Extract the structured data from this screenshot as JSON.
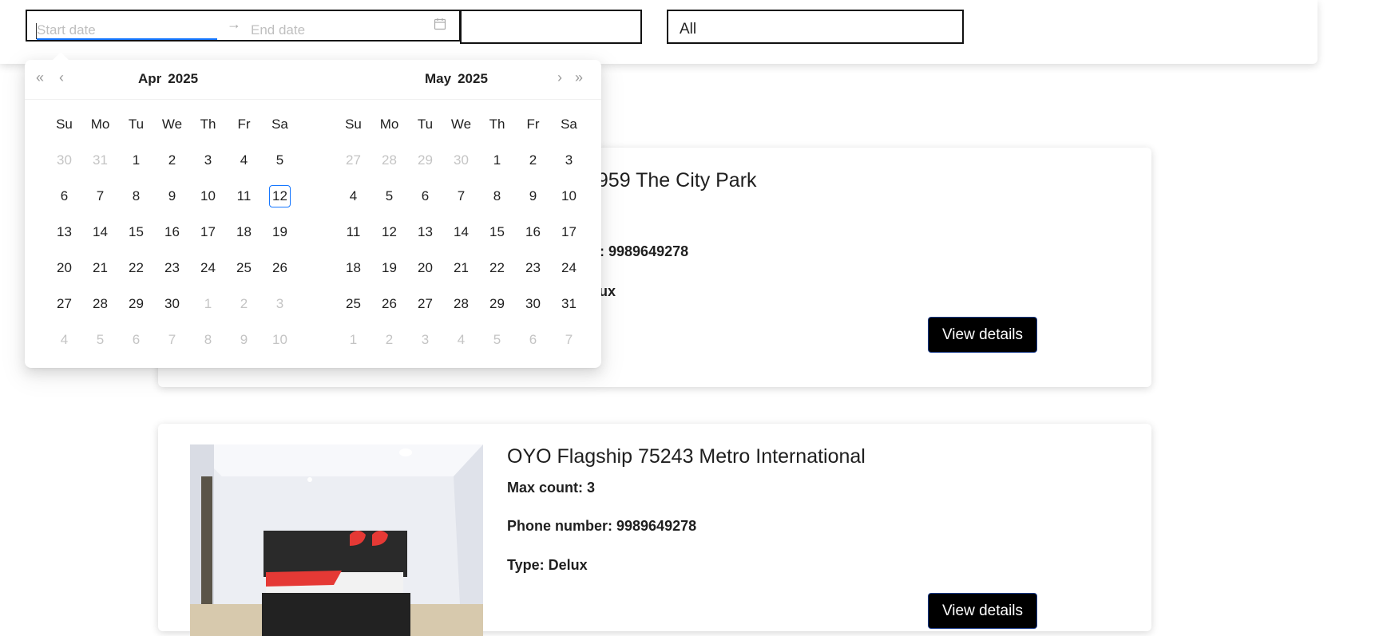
{
  "filters": {
    "start_placeholder": "Start date",
    "end_placeholder": "End date",
    "range_separator": "→",
    "type_value": "All"
  },
  "calendar": {
    "weekdays": [
      "Su",
      "Mo",
      "Tu",
      "We",
      "Th",
      "Fr",
      "Sa"
    ],
    "left": {
      "month": "Apr",
      "year": "2025",
      "days": [
        {
          "d": "30",
          "out": true
        },
        {
          "d": "31",
          "out": true
        },
        {
          "d": "1"
        },
        {
          "d": "2"
        },
        {
          "d": "3"
        },
        {
          "d": "4"
        },
        {
          "d": "5"
        },
        {
          "d": "6"
        },
        {
          "d": "7"
        },
        {
          "d": "8"
        },
        {
          "d": "9"
        },
        {
          "d": "10"
        },
        {
          "d": "11"
        },
        {
          "d": "12",
          "today": true
        },
        {
          "d": "13"
        },
        {
          "d": "14"
        },
        {
          "d": "15"
        },
        {
          "d": "16"
        },
        {
          "d": "17"
        },
        {
          "d": "18"
        },
        {
          "d": "19"
        },
        {
          "d": "20"
        },
        {
          "d": "21"
        },
        {
          "d": "22"
        },
        {
          "d": "23"
        },
        {
          "d": "24"
        },
        {
          "d": "25"
        },
        {
          "d": "26"
        },
        {
          "d": "27"
        },
        {
          "d": "28"
        },
        {
          "d": "29"
        },
        {
          "d": "30"
        },
        {
          "d": "1",
          "out": true
        },
        {
          "d": "2",
          "out": true
        },
        {
          "d": "3",
          "out": true
        },
        {
          "d": "4",
          "out": true
        },
        {
          "d": "5",
          "out": true
        },
        {
          "d": "6",
          "out": true
        },
        {
          "d": "7",
          "out": true
        },
        {
          "d": "8",
          "out": true
        },
        {
          "d": "9",
          "out": true
        },
        {
          "d": "10",
          "out": true
        }
      ]
    },
    "right": {
      "month": "May",
      "year": "2025",
      "days": [
        {
          "d": "27",
          "out": true
        },
        {
          "d": "28",
          "out": true
        },
        {
          "d": "29",
          "out": true
        },
        {
          "d": "30",
          "out": true
        },
        {
          "d": "1"
        },
        {
          "d": "2"
        },
        {
          "d": "3"
        },
        {
          "d": "4"
        },
        {
          "d": "5"
        },
        {
          "d": "6"
        },
        {
          "d": "7"
        },
        {
          "d": "8"
        },
        {
          "d": "9"
        },
        {
          "d": "10"
        },
        {
          "d": "11"
        },
        {
          "d": "12"
        },
        {
          "d": "13"
        },
        {
          "d": "14"
        },
        {
          "d": "15"
        },
        {
          "d": "16"
        },
        {
          "d": "17"
        },
        {
          "d": "18"
        },
        {
          "d": "19"
        },
        {
          "d": "20"
        },
        {
          "d": "21"
        },
        {
          "d": "22"
        },
        {
          "d": "23"
        },
        {
          "d": "24"
        },
        {
          "d": "25"
        },
        {
          "d": "26"
        },
        {
          "d": "27"
        },
        {
          "d": "28"
        },
        {
          "d": "29"
        },
        {
          "d": "30"
        },
        {
          "d": "31"
        },
        {
          "d": "1",
          "out": true
        },
        {
          "d": "2",
          "out": true
        },
        {
          "d": "3",
          "out": true
        },
        {
          "d": "4",
          "out": true
        },
        {
          "d": "5",
          "out": true
        },
        {
          "d": "6",
          "out": true
        },
        {
          "d": "7",
          "out": true
        }
      ]
    }
  },
  "hotels": [
    {
      "name": "5959 The City Park",
      "phone": "er: 9989649278",
      "type": "elux",
      "button": "View details"
    },
    {
      "name": "OYO Flagship 75243 Metro International",
      "max_count": "Max count: 3",
      "phone": "Phone number: 9989649278",
      "type": "Type: Delux",
      "button": "View details"
    }
  ],
  "colors": {
    "accent": "#1677ff",
    "button_bg": "#000000",
    "muted": "#c4c4c4"
  }
}
